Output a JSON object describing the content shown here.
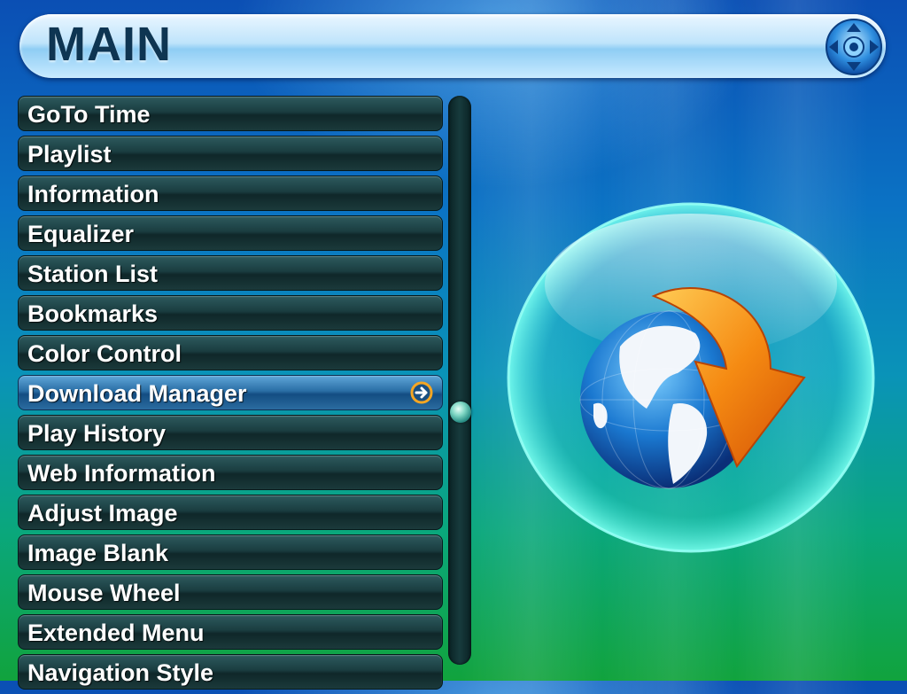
{
  "header": {
    "title": "MAIN"
  },
  "menu": {
    "items": [
      {
        "label": "GoTo Time"
      },
      {
        "label": "Playlist"
      },
      {
        "label": "Information"
      },
      {
        "label": "Equalizer"
      },
      {
        "label": "Station List"
      },
      {
        "label": "Bookmarks"
      },
      {
        "label": "Color Control"
      },
      {
        "label": "Download Manager"
      },
      {
        "label": "Play History"
      },
      {
        "label": "Web Information"
      },
      {
        "label": "Adjust Image"
      },
      {
        "label": "Image Blank"
      },
      {
        "label": "Mouse Wheel"
      },
      {
        "label": "Extended Menu"
      },
      {
        "label": "Navigation Style"
      }
    ],
    "selected_index": 7
  },
  "icons": {
    "navigation_pad": "navigation-pad-icon",
    "submenu_arrow": "arrow-right-circle-icon",
    "logo": "globe-download-logo"
  },
  "colors": {
    "selected_item": "#2a6ea5",
    "menu_item": "#1a3d40",
    "title_text": "#0e3552",
    "arrow_accent": "#f5a623"
  }
}
